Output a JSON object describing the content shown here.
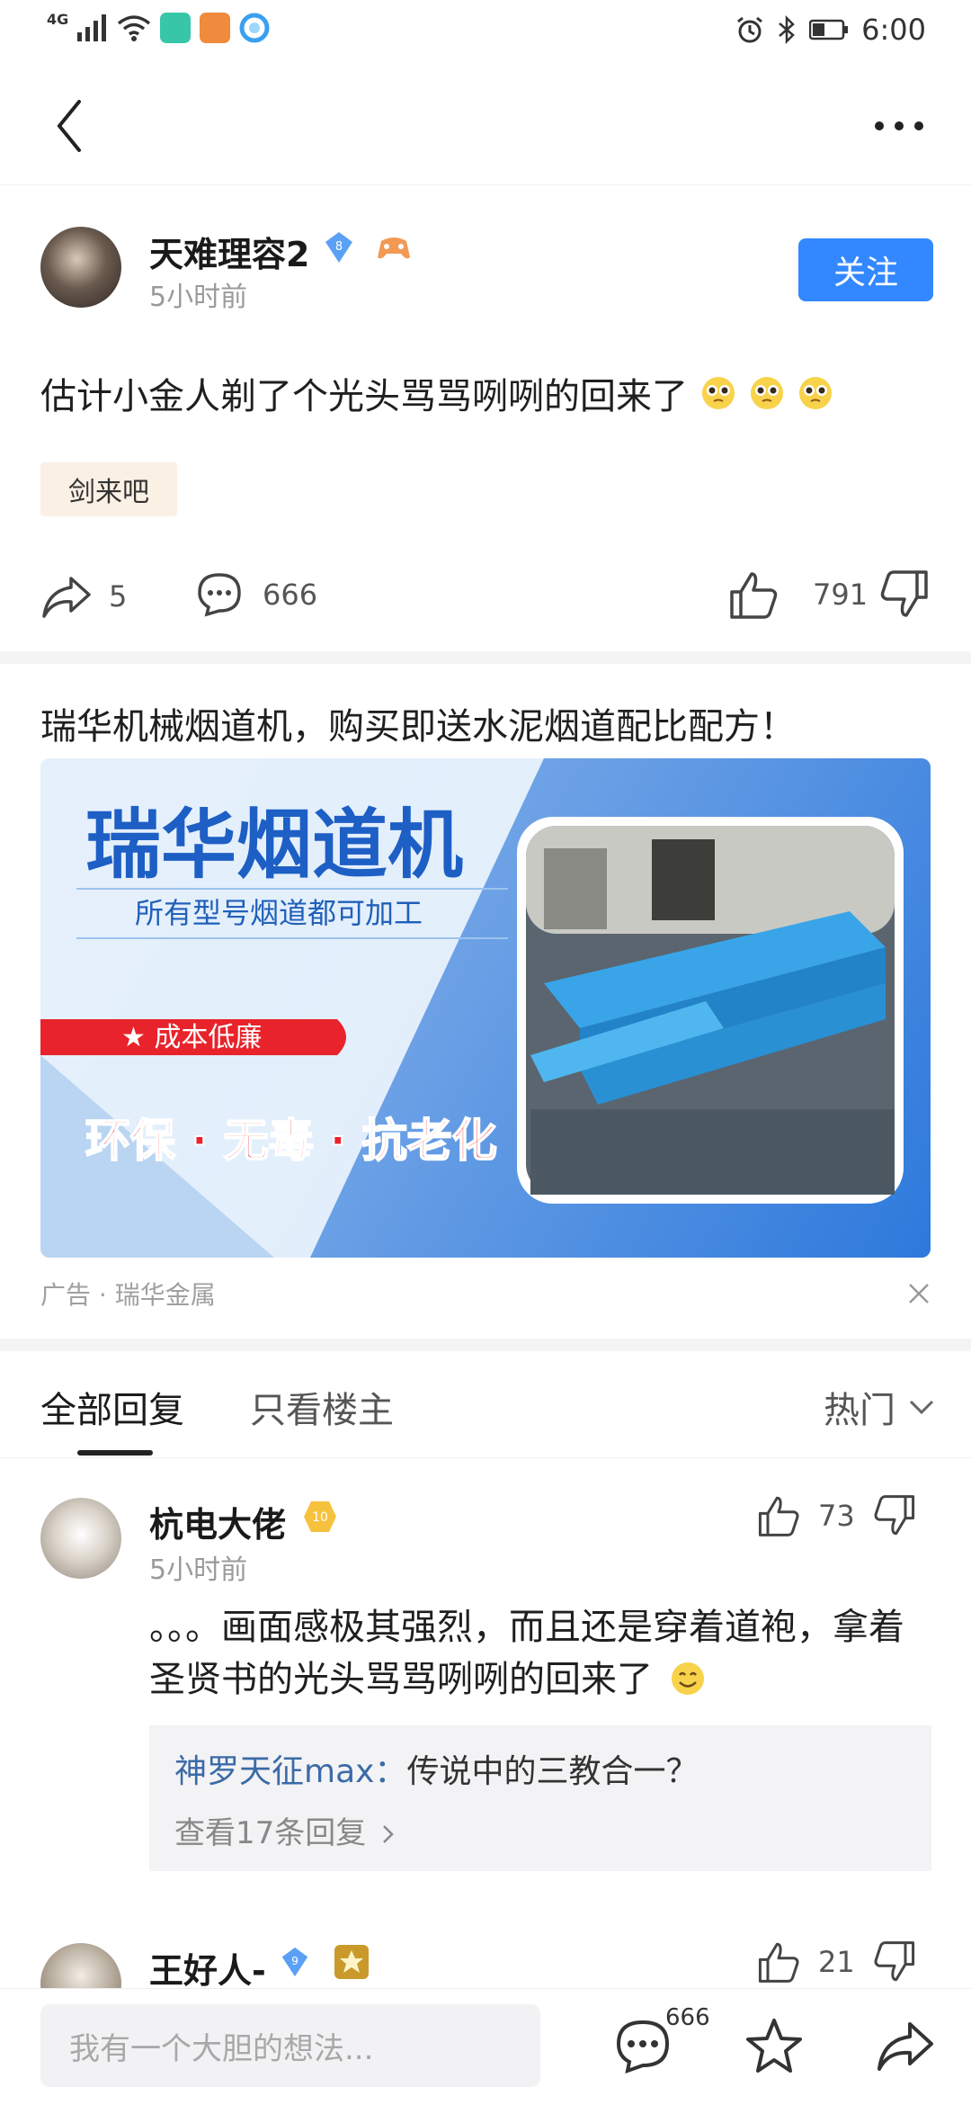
{
  "status_bar": {
    "network": "4G",
    "time": "6:00",
    "app_icons": [
      "mi-app-icon",
      "game-app-icon",
      "qq-browser-icon"
    ]
  },
  "topbar": {
    "back_icon": "back-arrow-icon",
    "more_icon": "more-dots-icon"
  },
  "post": {
    "author": "天难理容2",
    "level": "8",
    "time_ago": "5小时前",
    "follow_label": "关注",
    "text": "估计小金人剃了个光头骂骂咧咧的回来了",
    "emoji_count": 3,
    "tag": "剑来吧",
    "share_count": "5",
    "comment_count": "666",
    "like_count": "791"
  },
  "ad": {
    "title": "瑞华机械烟道机，购买即送水泥烟道配比配方！",
    "banner_headline": "瑞华烟道机",
    "banner_sub": "所有型号烟道都可加工",
    "banner_ribbon": "★ 成本低廉",
    "banner_slogan": "环保 · 无毒 · 抗老化",
    "source": "广告 · 瑞华金属"
  },
  "tabs": {
    "all_replies": "全部回复",
    "op_only": "只看楼主",
    "sort_label": "热门"
  },
  "replies": [
    {
      "author": "杭电大佬",
      "level": "10",
      "time_ago": "5小时前",
      "likes": "73",
      "text": "。。。画面感极其强烈，而且还是穿着道袍，拿着圣贤书的光头骂骂咧咧的回来了",
      "quote_author": "神罗天征max：",
      "quote_text": "传说中的三教合一？",
      "view_more": "查看17条回复"
    },
    {
      "author": "王好人-",
      "level": "9",
      "likes": "21"
    }
  ],
  "bottom_bar": {
    "input_placeholder": "我有一个大胆的想法...",
    "comment_badge": "666"
  },
  "colors": {
    "accent": "#3388ff",
    "tag_bg": "#fbf0e4",
    "ad_red": "#e8232b",
    "quote_name": "#3b6aa8"
  }
}
